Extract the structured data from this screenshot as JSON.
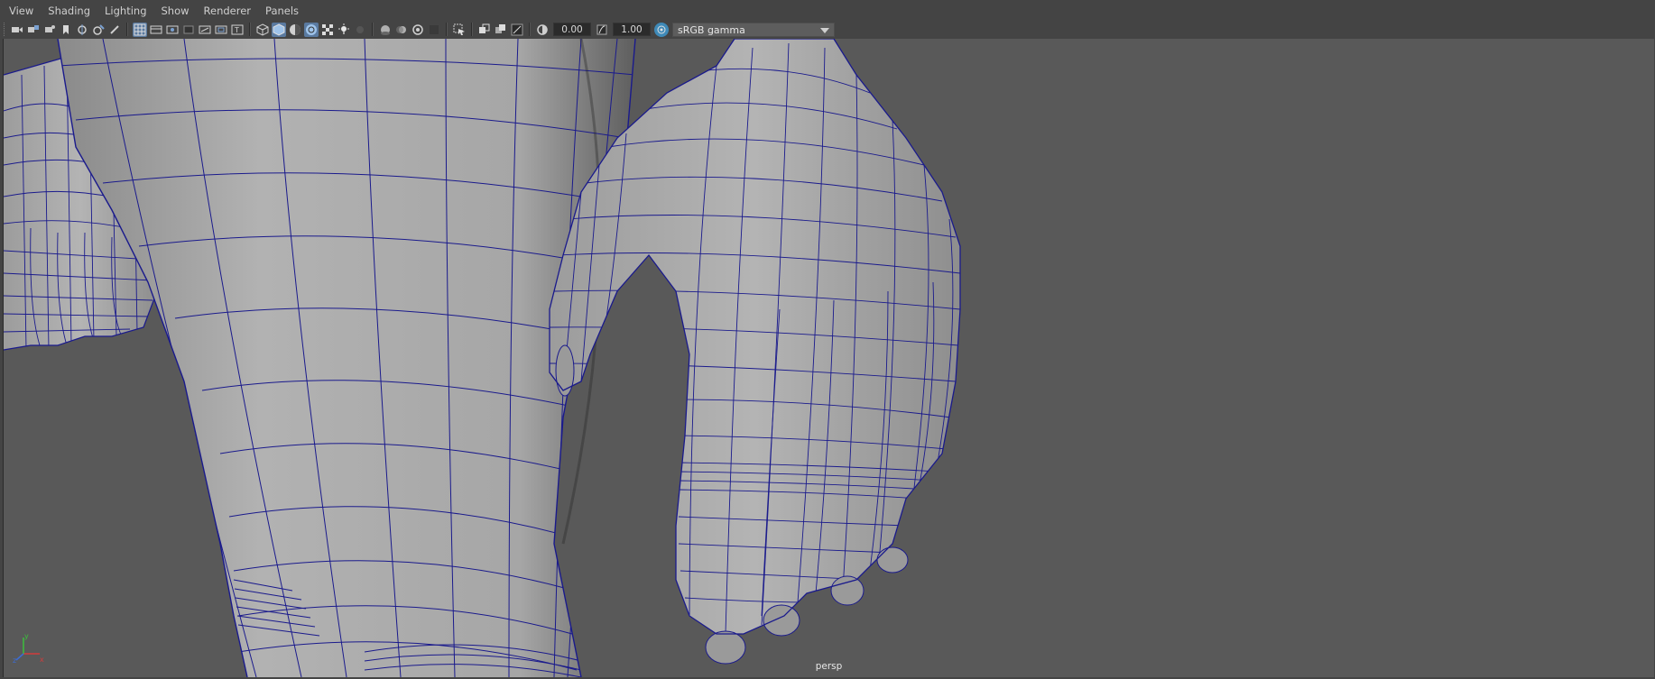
{
  "menubar": {
    "items": [
      "View",
      "Shading",
      "Lighting",
      "Show",
      "Renderer",
      "Panels"
    ]
  },
  "toolbar": {
    "exposure_value": "0.00",
    "gamma_value": "1.00",
    "color_space": "sRGB gamma"
  },
  "viewport": {
    "camera_name": "persp",
    "background_color": "#595959",
    "wireframe_color": "#1a1a8c",
    "mesh_color": "#a0a0a0"
  },
  "axis": {
    "x": "x",
    "y": "y",
    "z": "z"
  }
}
